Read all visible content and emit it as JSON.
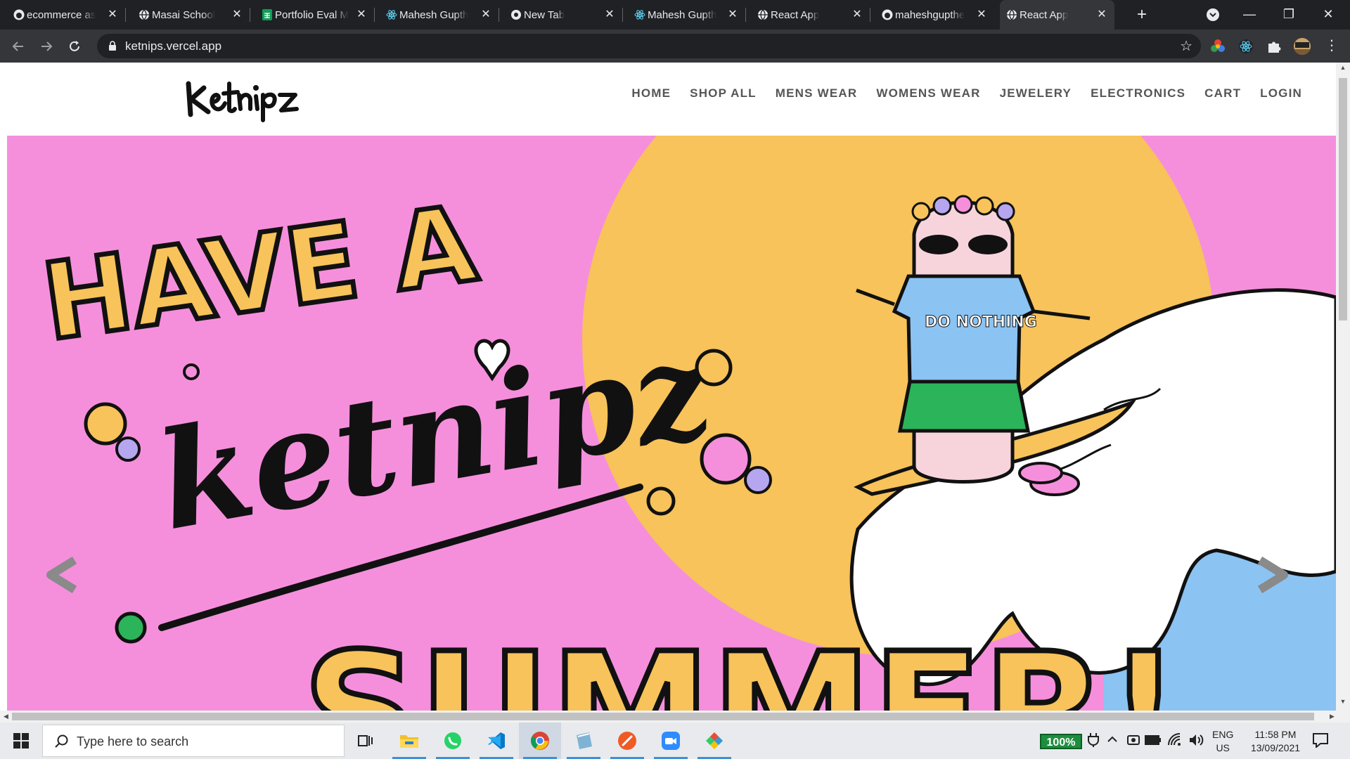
{
  "browser": {
    "tabs": [
      {
        "title": "ecommerce as",
        "icon": "github-icon",
        "active": false
      },
      {
        "title": "Masai School",
        "icon": "globe-icon",
        "active": false
      },
      {
        "title": "Portfolio Eval M",
        "icon": "sheets-icon",
        "active": false
      },
      {
        "title": "Mahesh Gupth",
        "icon": "react-icon",
        "active": false
      },
      {
        "title": "New Tab",
        "icon": "chrome-icon",
        "active": false
      },
      {
        "title": "Mahesh Gupth",
        "icon": "react-icon",
        "active": false
      },
      {
        "title": "React App",
        "icon": "globe-icon",
        "active": false
      },
      {
        "title": "maheshgupthe",
        "icon": "github-icon",
        "active": false
      },
      {
        "title": "React App",
        "icon": "globe-icon",
        "active": true
      }
    ],
    "close_glyph": "✕",
    "new_tab_glyph": "+",
    "url": "ketnips.vercel.app",
    "window_controls": {
      "minimize": "—",
      "restore": "❐",
      "close": "✕"
    }
  },
  "site": {
    "logo_text": "Ketnipz",
    "nav": [
      "HOME",
      "SHOP ALL",
      "MENS WEAR",
      "WOMENS WEAR",
      "JEWELERY",
      "ELECTRONICS",
      "CART",
      "LOGIN"
    ],
    "hero": {
      "headline_top": "HAVE A",
      "brand_script": "ketnipz",
      "headline_bottom": "SUMMER!",
      "shirt_text": "DO NOTHING",
      "prev_arrow": "<",
      "next_arrow": ">"
    }
  },
  "taskbar": {
    "search_placeholder": "Type here to search",
    "battery_percent": "100%",
    "language_top": "ENG",
    "language_bottom": "US",
    "time": "11:58 PM",
    "date": "13/09/2021"
  },
  "colors": {
    "hero_pink": "#f58fdc",
    "hero_sun": "#f7c35a",
    "hero_blue": "#8bc3f3"
  }
}
